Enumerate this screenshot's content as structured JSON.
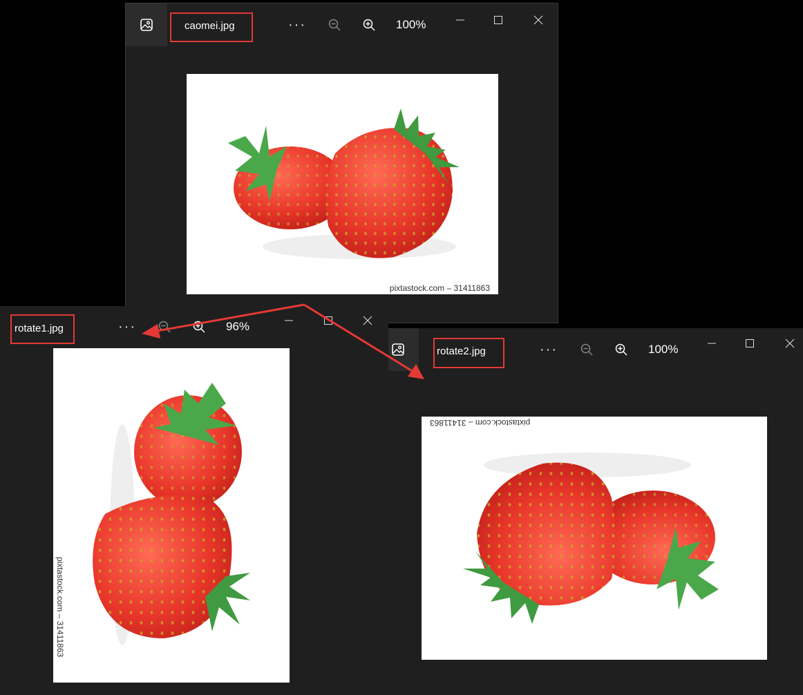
{
  "windows": [
    {
      "id": "caomei",
      "title": "caomei.jpg",
      "zoom": "100%",
      "watermark": "pixtastock.com – 31411863"
    },
    {
      "id": "rotate1",
      "title": "rotate1.jpg",
      "zoom": "96%",
      "watermark": "pixtastock.com – 31411863"
    },
    {
      "id": "rotate2",
      "title": "rotate2.jpg",
      "zoom": "100%",
      "watermark": "pixtastock.com – 31411863"
    }
  ],
  "toolbar": {
    "more_label": "···"
  },
  "colors": {
    "window_bg": "#1f1f1f",
    "highlight": "#e53935",
    "strawberry": "#e8352a",
    "leaf": "#4aa84a"
  },
  "icons": [
    "photos-app-icon",
    "more-icon",
    "zoom-out-icon",
    "zoom-in-icon",
    "minimize-icon",
    "maximize-icon",
    "close-icon"
  ]
}
